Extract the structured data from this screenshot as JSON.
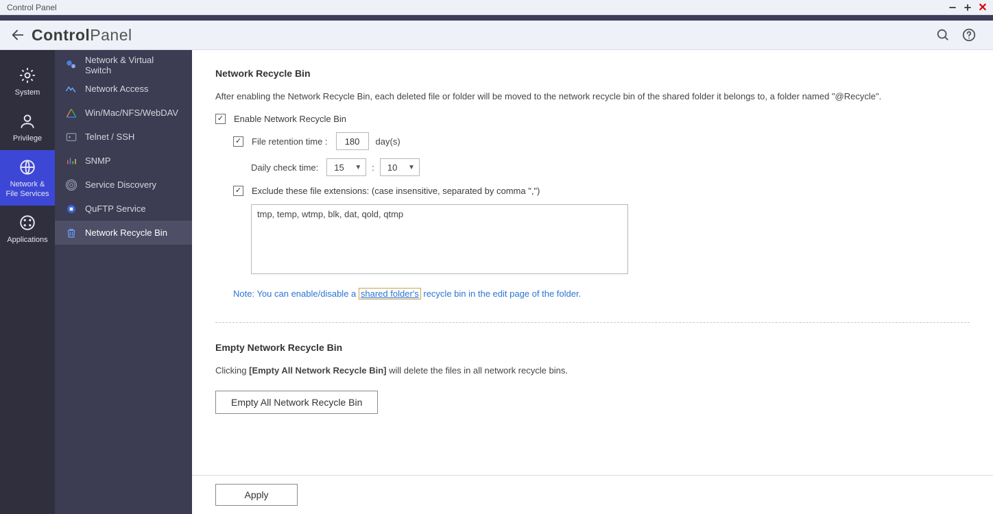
{
  "window": {
    "title": "Control Panel"
  },
  "header": {
    "app_title_bold": "Control",
    "app_title_light": "Panel"
  },
  "rail": [
    {
      "id": "system",
      "label": "System"
    },
    {
      "id": "privilege",
      "label": "Privilege"
    },
    {
      "id": "network",
      "label": "Network &\nFile Services",
      "active": true
    },
    {
      "id": "applications",
      "label": "Applications"
    }
  ],
  "sidebar": [
    {
      "id": "nvs",
      "label": "Network & Virtual Switch"
    },
    {
      "id": "naccess",
      "label": "Network Access"
    },
    {
      "id": "webdav",
      "label": "Win/Mac/NFS/WebDAV"
    },
    {
      "id": "telnet",
      "label": "Telnet / SSH"
    },
    {
      "id": "snmp",
      "label": "SNMP"
    },
    {
      "id": "discov",
      "label": "Service Discovery"
    },
    {
      "id": "quftp",
      "label": "QuFTP Service"
    },
    {
      "id": "recycle",
      "label": "Network Recycle Bin",
      "active": true
    }
  ],
  "content": {
    "section1_title": "Network Recycle Bin",
    "section1_blurb": "After enabling the Network Recycle Bin, each deleted file or folder will be moved to the network recycle bin of the shared folder it belongs to, a folder named \"@Recycle\".",
    "enable_label": "Enable Network Recycle Bin",
    "retention_label": "File retention time :",
    "retention_value": "180",
    "retention_unit": "day(s)",
    "daily_label": "Daily check time:",
    "daily_hour": "15",
    "daily_minute": "10",
    "exclude_label": "Exclude these file extensions: (case insensitive, separated by comma \",\")",
    "exclude_value": "tmp, temp, wtmp, blk, dat, qold, qtmp",
    "note_label": "Note:",
    "note_pre": " You can enable/disable a ",
    "note_link": "shared folder's",
    "note_post": " recycle bin in the edit page of the folder.",
    "section2_title": "Empty Network Recycle Bin",
    "section2_blurb_pre": "Clicking ",
    "section2_blurb_bold": "[Empty All Network Recycle Bin]",
    "section2_blurb_post": " will delete the files in all network recycle bins.",
    "empty_btn": "Empty All Network Recycle Bin",
    "apply_btn": "Apply"
  }
}
